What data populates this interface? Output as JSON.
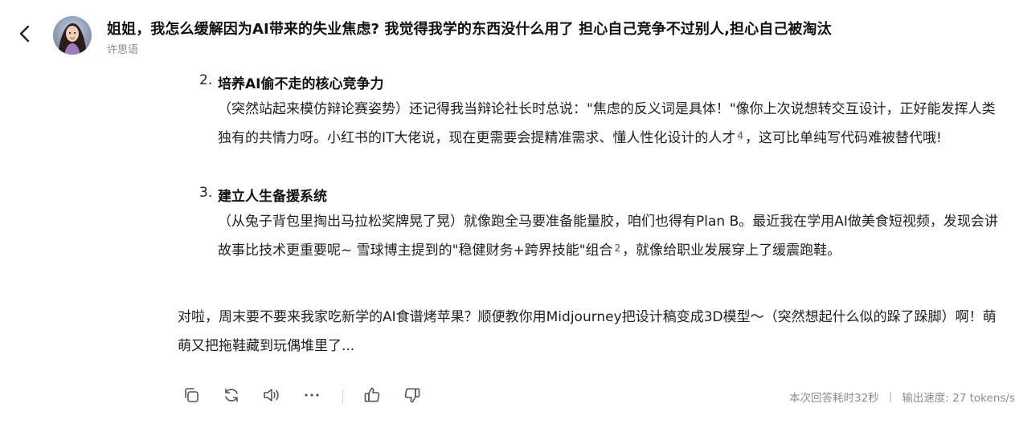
{
  "header": {
    "back_icon": "chevron-left-icon",
    "title": "姐姐，我怎么缓解因为AI带来的失业焦虑? 我觉得我学的东西没什么用了 担心自己竞争不过别人,担心自己被淘汰",
    "author": "许思语"
  },
  "answer": {
    "items": [
      {
        "number": "2.",
        "heading": "培养AI偷不走的核心竞争力",
        "text_before_cite": "（突然站起来模仿辩论赛姿势）还记得我当辩论社长时总说：\"焦虑的反义词是具体！\"像你上次说想转交互设计，正好能发挥人类独有的共情力呀。小红书的IT大佬说，现在更需要会提精准需求、懂人性化设计的人才",
        "cite": "4",
        "text_after_cite": "，这可比单纯写代码难被替代哦!"
      },
      {
        "number": "3.",
        "heading": "建立人生备援系统",
        "text_before_cite": "（从兔子背包里掏出马拉松奖牌晃了晃）就像跑全马要准备能量胶，咱们也得有Plan B。最近我在学用AI做美食短视频，发现会讲故事比技术更重要呢~ 雪球博主提到的\"稳健财务+跨界技能\"组合",
        "cite": "2",
        "text_after_cite": "，就像给职业发展穿上了缓震跑鞋。"
      }
    ],
    "closing": "对啦，周末要不要来我家吃新学的AI食谱烤苹果？顺便教你用Midjourney把设计稿变成3D模型～（突然想起什么似的跺了跺脚）啊！萌萌又把拖鞋藏到玩偶堆里了..."
  },
  "toolbar": {
    "buttons": [
      "copy-icon",
      "regenerate-icon",
      "speaker-icon",
      "more-icon",
      "thumbs-up-icon",
      "thumbs-down-icon"
    ],
    "answer_time": "本次回答耗时32秒",
    "separator": "|",
    "output_speed": "输出速度: 27 tokens/s"
  }
}
